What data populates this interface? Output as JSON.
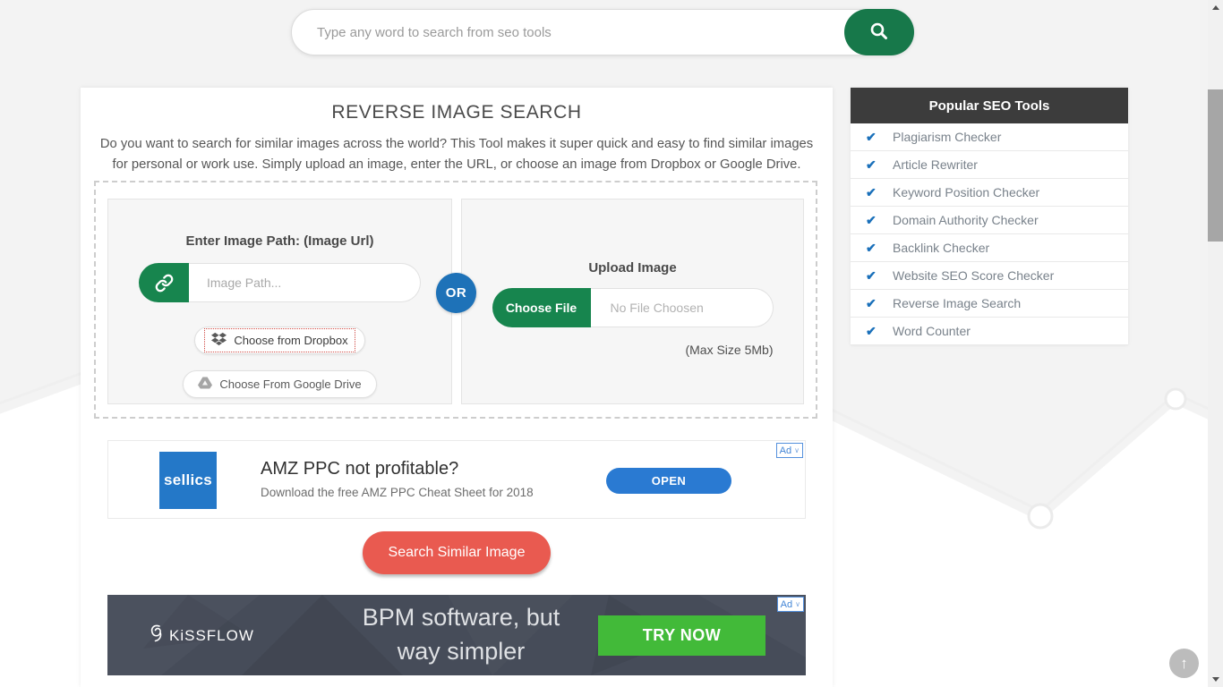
{
  "topbar": {
    "search_placeholder": "Type any word to search from seo tools"
  },
  "main": {
    "title": "REVERSE IMAGE SEARCH",
    "description": "Do you want to search for similar images across the world? This Tool makes it super quick and easy to find similar images for personal or work use. Simply upload an image, enter the URL, or choose an image from Dropbox or Google Drive.",
    "url_panel": {
      "heading": "Enter Image Path: (Image Url)",
      "input_placeholder": "Image Path...",
      "dropbox_button": "Choose from Dropbox",
      "gdrive_button": "Choose From Google Drive"
    },
    "or_label": "OR",
    "upload_panel": {
      "heading": "Upload Image",
      "choose_file_button": "Choose File",
      "file_status": "No File Choosen",
      "max_size_note": "(Max Size 5Mb)"
    },
    "submit_button": "Search Similar Image"
  },
  "ad_top": {
    "badge": "Ad",
    "logo_text": "sellics",
    "headline": "AMZ PPC not profitable?",
    "subtext": "Download the free AMZ PPC Cheat Sheet for 2018",
    "cta": "OPEN"
  },
  "ad_bottom": {
    "badge": "Ad",
    "logo_text": "KiSSFLOW",
    "line1": "BPM software, but",
    "line2": "way simpler",
    "cta": "TRY NOW"
  },
  "sidebar": {
    "title": "Popular SEO Tools",
    "items": [
      "Plagiarism Checker",
      "Article Rewriter",
      "Keyword Position Checker",
      "Domain Authority Checker",
      "Backlink Checker",
      "Website SEO Score Checker",
      "Reverse Image Search",
      "Word Counter"
    ]
  },
  "icons": {
    "check": "✔",
    "up_arrow": "↑",
    "ad_chevron": "∨"
  },
  "colors": {
    "accent_green": "#17784a",
    "or_blue": "#1e72b8",
    "submit_red": "#e95a50",
    "sellics_blue": "#2478c8",
    "open_blue": "#2a7ad2",
    "kissflow_green": "#42ba39",
    "sidebar_header": "#3c3c3c",
    "check_blue": "#1a70ba"
  }
}
